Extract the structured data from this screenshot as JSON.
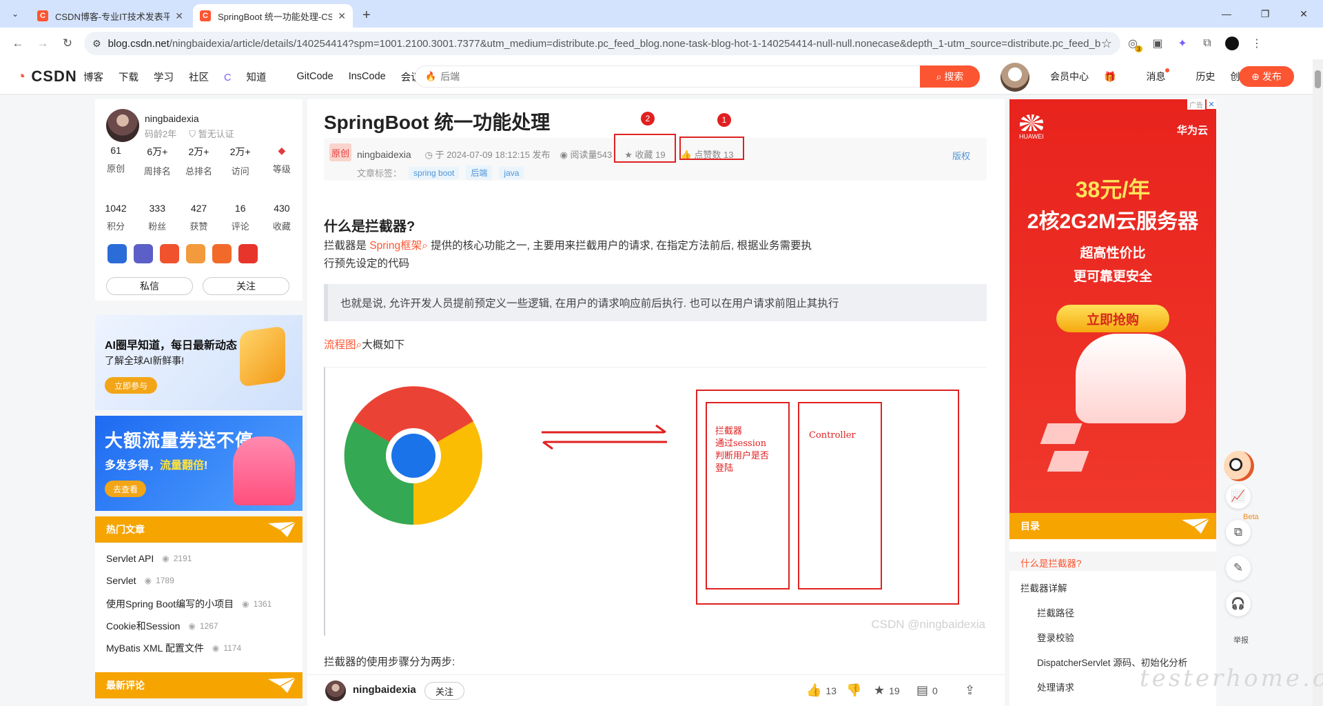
{
  "browser": {
    "tabs": [
      {
        "title": "CSDN博客-专业IT技术发表平台",
        "active": false
      },
      {
        "title": "SpringBoot 统一功能处理-CSDN",
        "active": true
      }
    ],
    "url_host": "blog.csdn.net",
    "url_rest": "/ningbaidexia/article/details/140254414?spm=1001.2100.3001.7377&utm_medium=distribute.pc_feed_blog.none-task-blog-hot-1-140254414-null-null.nonecase&depth_1-utm_source=distribute.pc_feed_b...",
    "ext_badge": "3"
  },
  "header": {
    "logo": "CSDN",
    "nav": [
      "博客",
      "下载",
      "学习",
      "社区",
      "知道",
      "GitCode",
      "InsCode",
      "会议"
    ],
    "search_placeholder": "后端",
    "search_button": "搜索",
    "right_nav": [
      "会员中心",
      "消息",
      "历史",
      "创作中心"
    ],
    "publish": "发布"
  },
  "profile": {
    "name": "ningbaidexia",
    "age": "码龄2年",
    "cert": "暂无认证",
    "stats1": [
      {
        "n": "61",
        "l": "原创"
      },
      {
        "n": "6万+",
        "l": "周排名"
      },
      {
        "n": "2万+",
        "l": "总排名"
      },
      {
        "n": "2万+",
        "l": "访问"
      },
      {
        "n": "",
        "l": "等级"
      }
    ],
    "stats2": [
      {
        "n": "1042",
        "l": "积分"
      },
      {
        "n": "333",
        "l": "粉丝"
      },
      {
        "n": "427",
        "l": "获赞"
      },
      {
        "n": "16",
        "l": "评论"
      },
      {
        "n": "430",
        "l": "收藏"
      }
    ],
    "btn_msg": "私信",
    "btn_follow": "关注"
  },
  "ads_left": {
    "ad1_title": "圈早知道，每日最新动态",
    "ad1_ai": "AI",
    "ad1_sub": "了解全球AI新鲜事!",
    "ad1_btn": "立即参与",
    "ad2_title": "大额流量券送不停",
    "ad2_sub1": "多发多得，",
    "ad2_sub2": "流量翻倍",
    "ad2_sub3": "!",
    "ad2_btn": "去查看"
  },
  "hot": {
    "title": "热门文章",
    "items": [
      {
        "t": "Servlet API",
        "c": "2191"
      },
      {
        "t": "Servlet",
        "c": "1789"
      },
      {
        "t": "使用Spring Boot编写的小项目",
        "c": "1361"
      },
      {
        "t": "Cookie和Session",
        "c": "1267"
      },
      {
        "t": "MyBatis XML 配置文件",
        "c": "1174"
      }
    ],
    "comments_title": "最新评论"
  },
  "article": {
    "title": "SpringBoot 统一功能处理",
    "orig": "原创",
    "author": "ningbaidexia",
    "date": "于 2024-07-09 18:12:15 发布",
    "reads": "阅读量543",
    "favs": "收藏 19",
    "likes": "点赞数 13",
    "copyright": "版权",
    "tags_label": "文章标签：",
    "tags": [
      "spring boot",
      "后端",
      "java"
    ],
    "annot1": "1",
    "annot2": "2",
    "h2": "什么是拦截器?",
    "p1a": "拦截器是 ",
    "p1link": "Spring框架",
    "p1b": " 提供的核心功能之一, 主要用来拦截用户的请求, 在指定方法前后, 根据业务需要执",
    "p1c": "行预先设定的代码",
    "quote": "也就是说, 允许开发人员提前预定义一些逻辑, 在用户的请求响应前后执行. 也可以在用户请求前阻止其执行",
    "p2link": "流程图",
    "p2": "大概如下",
    "diag_interceptor": [
      "拦截器",
      "通过session",
      "判断用户是否",
      "登陆"
    ],
    "diag_controller": "Controller",
    "watermark": "CSDN @ningbaidexia",
    "p3": "拦截器的使用步骤分为两步:"
  },
  "bottombar": {
    "author": "ningbaidexia",
    "follow": "关注",
    "likes": "13",
    "favs": "19",
    "comments": "0"
  },
  "ad_right": {
    "label": "广告",
    "brand": "HUAWEI",
    "brand_cn": "华为云",
    "price": "38元/年",
    "spec": "2核2G2M云服务器",
    "l1": "超高性价比",
    "l2": "更可靠更安全",
    "btn": "立即抢购"
  },
  "toc": {
    "title": "目录",
    "items": [
      {
        "t": "什么是拦截器?",
        "lvl": 1,
        "cur": true
      },
      {
        "t": "拦截器详解",
        "lvl": 1,
        "cur": false
      },
      {
        "t": "拦截路径",
        "lvl": 2,
        "cur": false
      },
      {
        "t": "登录校验",
        "lvl": 2,
        "cur": false
      },
      {
        "t": "DispatcherServlet 源码、初始化分析",
        "lvl": 2,
        "cur": false
      },
      {
        "t": "处理请求",
        "lvl": 2,
        "cur": false
      }
    ]
  },
  "sidetools": {
    "beta": "Beta",
    "report": "举报"
  },
  "site_watermark": "testerhome.com",
  "colors": {
    "brand": "#fc5531",
    "annot": "#e02020",
    "toc_head": "#f6a400"
  }
}
